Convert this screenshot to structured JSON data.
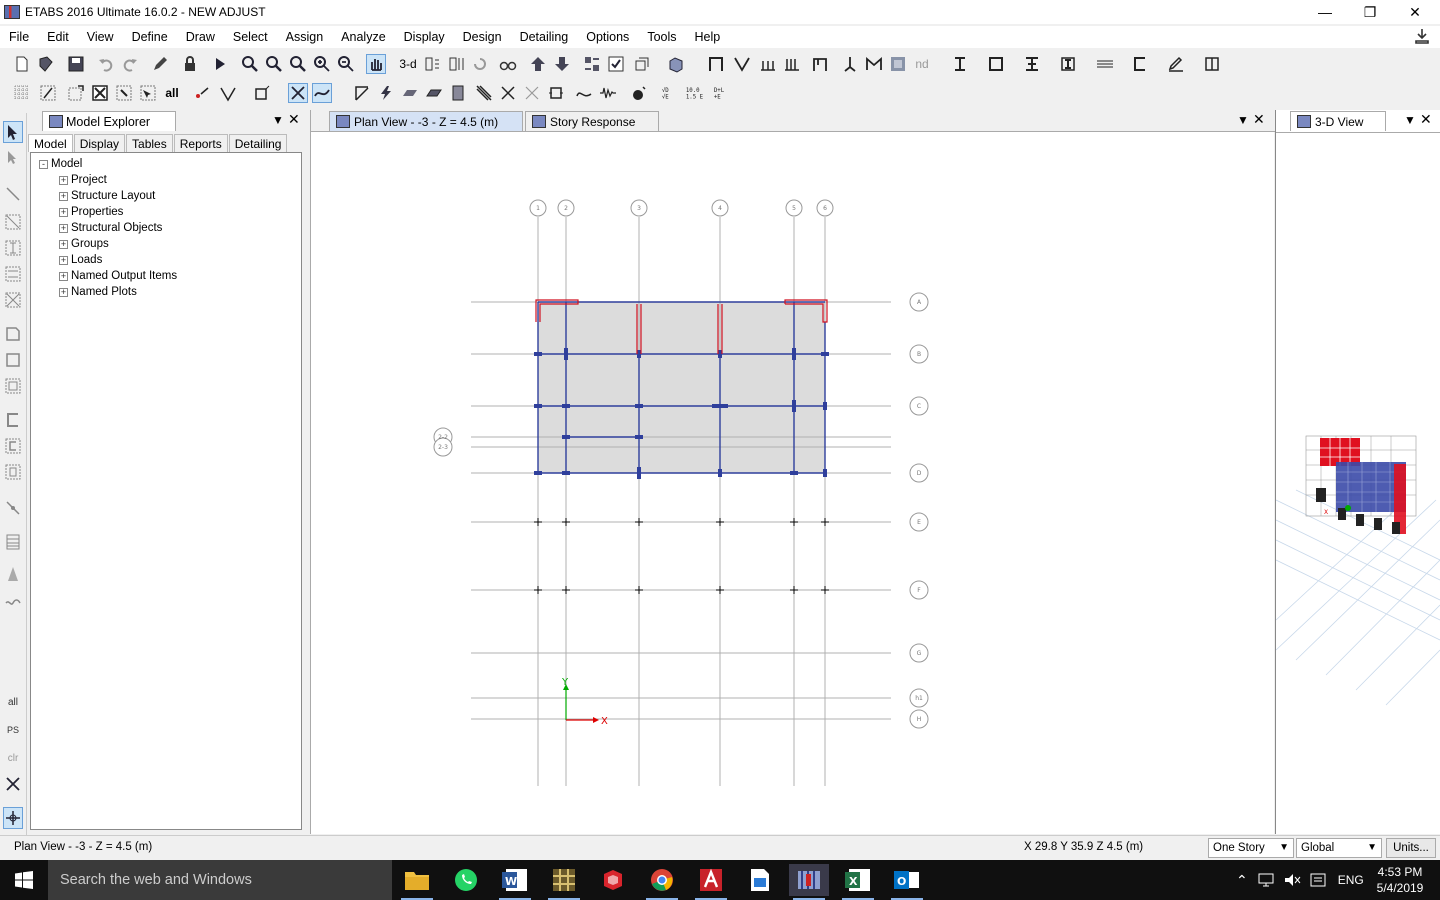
{
  "window": {
    "title": "ETABS 2016 Ultimate 16.0.2 - NEW ADJUST"
  },
  "menu": [
    "File",
    "Edit",
    "View",
    "Define",
    "Draw",
    "Select",
    "Assign",
    "Analyze",
    "Display",
    "Design",
    "Detailing",
    "Options",
    "Tools",
    "Help"
  ],
  "toolbar": {
    "view_3d_label": "3-d",
    "nd_label": "nd",
    "all_label": "all"
  },
  "explorer": {
    "title": "Model Explorer",
    "tabs": [
      "Model",
      "Display",
      "Tables",
      "Reports",
      "Detailing"
    ],
    "root": "Model",
    "items": [
      "Project",
      "Structure Layout",
      "Properties",
      "Structural Objects",
      "Groups",
      "Loads",
      "Named Output Items",
      "Named Plots"
    ]
  },
  "left_tools": {
    "all": "all",
    "ps": "PS",
    "clr": "clr"
  },
  "view_tabs": [
    {
      "label": "Plan View - -3 - Z = 4.5 (m)",
      "selected": true
    },
    {
      "label": "Story Response",
      "selected": false
    }
  ],
  "right_panel": {
    "title": "3-D View"
  },
  "plan": {
    "grid_x": [
      "1",
      "2",
      "3",
      "4",
      "5",
      "6"
    ],
    "grid_y": [
      "A",
      "B",
      "C",
      "D",
      "E",
      "F",
      "G",
      "h1",
      "H"
    ],
    "grid_extra": [
      "2-2",
      "2-3"
    ],
    "axis_x": "X",
    "axis_y": "Y"
  },
  "status": {
    "left": "Plan View - -3 - Z = 4.5 (m)",
    "coords": "X 29.8  Y 35.9  Z 4.5 (m)",
    "story_option": "One Story",
    "coord_system": "Global",
    "units_button": "Units..."
  },
  "taskbar": {
    "search_placeholder": "Search the web and Windows",
    "language": "ENG",
    "time": "4:53 PM",
    "date": "5/4/2019"
  },
  "colors": {
    "accent": "#2f3f9c",
    "wall": "#d01020",
    "grid": "#b0b0b0",
    "slab": "#dcdcdc"
  }
}
